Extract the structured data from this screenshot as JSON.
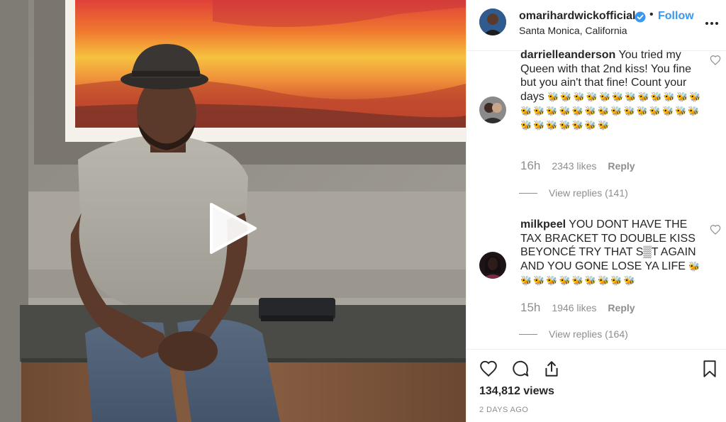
{
  "post": {
    "author": "omarihardwickofficial",
    "location": "Santa Monica, California",
    "follow_label": "Follow",
    "separator": "•"
  },
  "comments": [
    {
      "user": "darrielleanderson",
      "text": "You tried my Queen with that 2nd kiss! You fine but you ain't that fine! Count your days",
      "emoji": "🐝🐝🐝🐝🐝🐝🐝🐝🐝🐝🐝🐝🐝🐝🐝🐝🐝🐝🐝🐝🐝🐝🐝🐝🐝🐝🐝🐝🐝🐝🐝🐝🐝",
      "time": "16h",
      "likes": "2343 likes",
      "reply_label": "Reply",
      "view_replies": "View replies (141)"
    },
    {
      "user": "milkpeel",
      "text": "YOU DONT HAVE THE TAX BRACKET TO DOUBLE KISS BEYONCÉ TRY THAT S▒T AGAIN AND YOU GONE LOSE YA LIFE",
      "emoji": "🐝🐝🐝🐝🐝🐝🐝🐝🐝🐝",
      "time": "15h",
      "likes": "1946 likes",
      "reply_label": "Reply",
      "view_replies": "View replies (164)"
    }
  ],
  "stats": {
    "views": "134,812 views",
    "posted": "2 DAYS AGO"
  },
  "icons": {
    "verified": "verified-badge-icon",
    "more": "more-options-icon",
    "like": "heart-icon",
    "comment": "comment-bubble-icon",
    "share": "share-icon",
    "save": "bookmark-icon",
    "play": "play-icon"
  },
  "colors": {
    "accent": "#3897f0",
    "muted": "#8e8e8e",
    "text": "#262626"
  }
}
